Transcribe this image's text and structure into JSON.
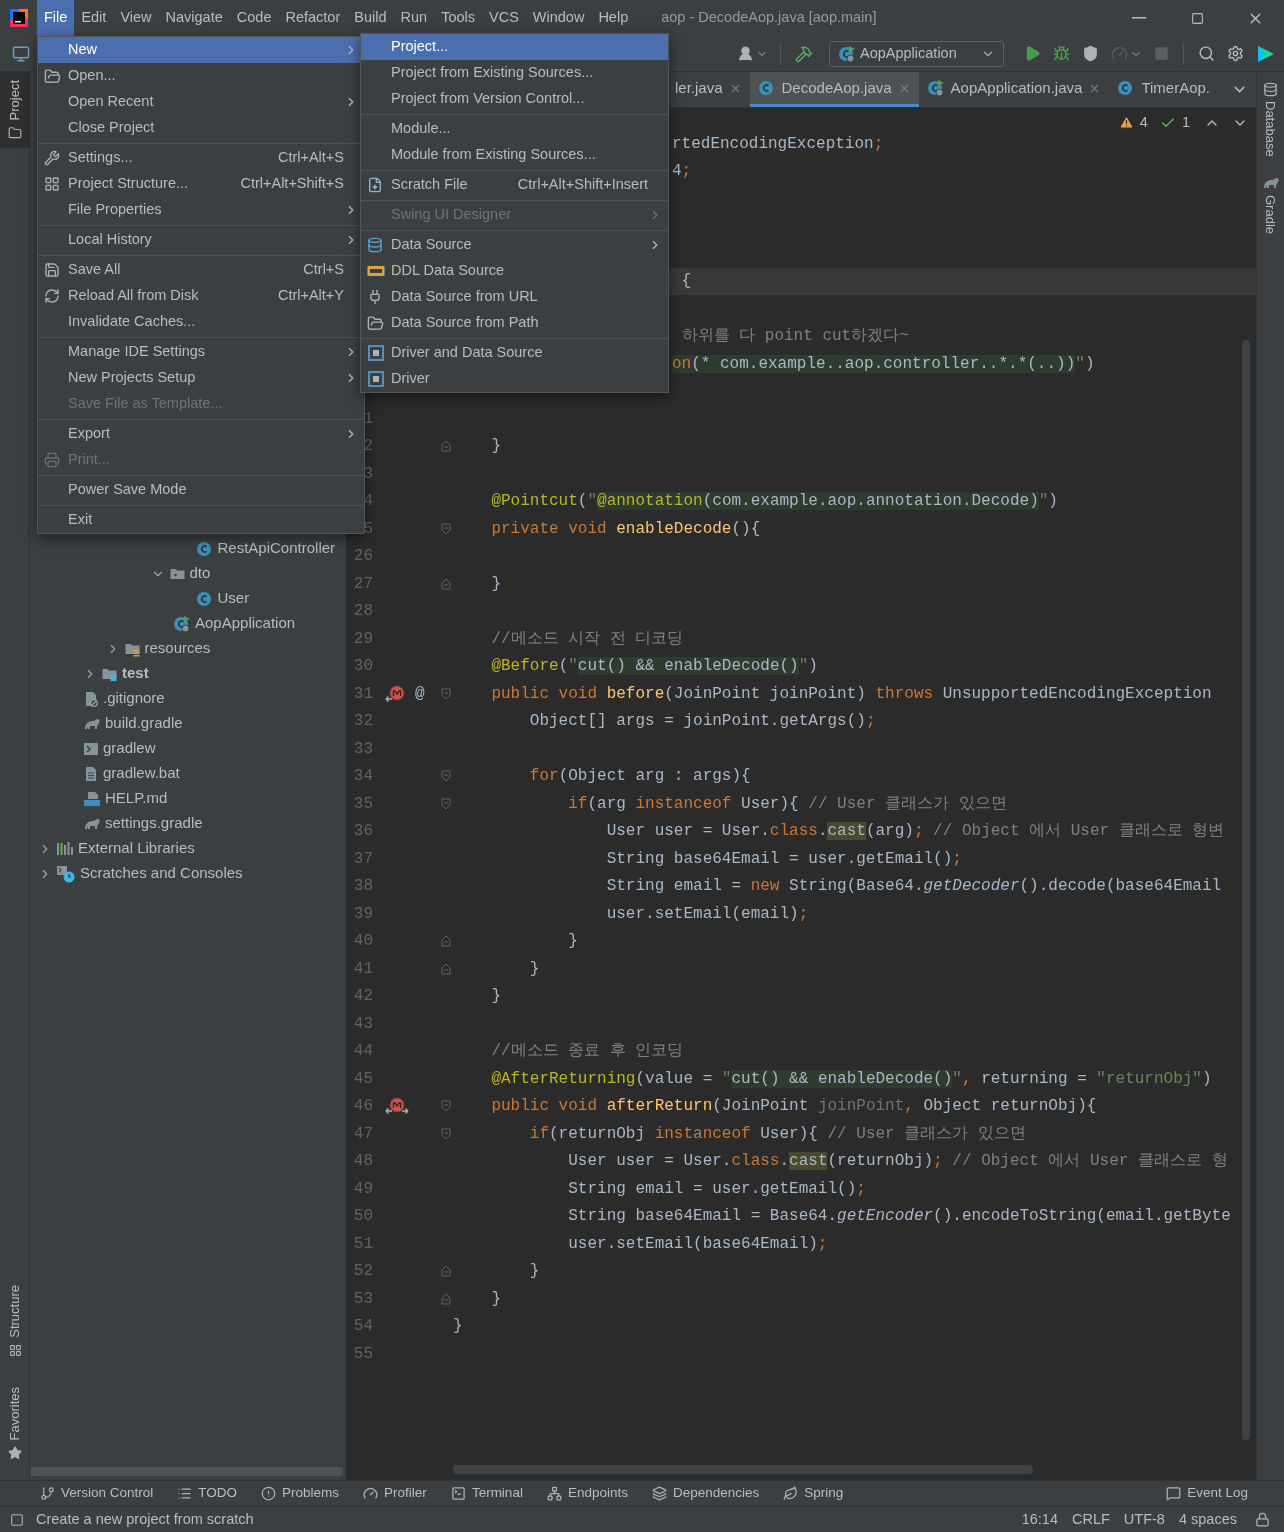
{
  "title_bar": {
    "menus": [
      {
        "label": "File",
        "selected": true
      },
      {
        "label": "Edit",
        "selected": false
      },
      {
        "label": "View",
        "selected": false
      },
      {
        "label": "Navigate",
        "selected": false
      },
      {
        "label": "Code",
        "selected": false
      },
      {
        "label": "Refactor",
        "selected": false
      },
      {
        "label": "Build",
        "selected": false
      },
      {
        "label": "Run",
        "selected": false
      },
      {
        "label": "Tools",
        "selected": false
      },
      {
        "label": "VCS",
        "selected": false
      },
      {
        "label": "Window",
        "selected": false
      },
      {
        "label": "Help",
        "selected": false
      }
    ],
    "title": "aop - DecodeAop.java [aop.main]"
  },
  "toolbar": {
    "run_configuration": "AopApplication"
  },
  "left_strip": {
    "top": [
      {
        "label": "Project",
        "selected": true,
        "kind": "folder"
      }
    ],
    "bottom": [
      {
        "label": "Structure",
        "selected": false,
        "kind": "structure"
      },
      {
        "label": "Favorites",
        "selected": false,
        "kind": "star"
      }
    ]
  },
  "right_strip": [
    {
      "label": "Database",
      "kind": "database"
    },
    {
      "label": "Gradle",
      "kind": "elephant"
    }
  ],
  "project_tree": [
    {
      "children": [
        {
          "children": [
            {
              "children": [
                {
                  "children": [
                    {
                      "children": [
                        {
                          "children": [
                            {
                              "label": "RestApiController",
                              "kind": "class"
                            }
                          ]
                        },
                        {
                          "label": "dto",
                          "kind": "package",
                          "expanded": true,
                          "children": [
                            {
                              "label": "User",
                              "kind": "class"
                            }
                          ]
                        },
                        {
                          "label": "AopApplication",
                          "kind": "app"
                        }
                      ]
                    }
                  ]
                },
                {
                  "label": "resources",
                  "kind": "resources",
                  "expanded": false
                }
              ]
            },
            {
              "label": "test",
              "kind": "test_root",
              "expanded": false
            }
          ]
        },
        {
          "label": ".gitignore",
          "kind": "ignore"
        },
        {
          "label": "build.gradle",
          "kind": "gradle"
        },
        {
          "label": "gradlew",
          "kind": "shell"
        },
        {
          "label": "gradlew.bat",
          "kind": "text"
        },
        {
          "label": "HELP.md",
          "kind": "markdown"
        },
        {
          "label": "settings.gradle",
          "kind": "gradle"
        }
      ]
    },
    {
      "label": "External Libraries",
      "kind": "libraries",
      "expanded": false
    },
    {
      "label": "Scratches and Consoles",
      "kind": "scratches",
      "expanded": false
    }
  ],
  "editor": {
    "tabs": [
      {
        "label": "ler.java",
        "selected": false,
        "closable": true
      },
      {
        "label": "DecodeAop.java",
        "kind": "class",
        "selected": true,
        "closable": true
      },
      {
        "label": "AopApplication.java",
        "kind": "app",
        "selected": false,
        "closable": true
      },
      {
        "label": "TimerAop.",
        "kind": "class",
        "selected": false,
        "closable": false
      }
    ],
    "inspections": {
      "warnings": "4",
      "weak_warnings": "1"
    },
    "lines": [
      {
        "kind": "clipped",
        "tokens": [
          {
            "text": "rtedEncodingException",
            "kind": "plain"
          },
          {
            "text": ";",
            "kind": "kw"
          }
        ]
      },
      {
        "kind": "clipped",
        "tokens": [
          {
            "text": "4",
            "kind": "plain"
          },
          {
            "text": ";",
            "kind": "kw"
          }
        ]
      },
      {
        "kind": "blank"
      },
      {
        "kind": "blank"
      },
      {
        "kind": "blank"
      },
      {
        "kind": "clipped",
        "current": true,
        "tokens": [
          {
            "text": " {",
            "kind": "plain"
          }
        ]
      },
      {
        "kind": "blank"
      },
      {
        "kind": "clipped",
        "tokens": [
          {
            "text": " 하위를 다 point cut하겠다~",
            "kind": "com"
          }
        ]
      },
      {
        "kind": "clipped",
        "tokens": [
          {
            "text": "on",
            "kind": "injkw"
          },
          {
            "text": "(* com.example..aop.controller..*.*(..))",
            "kind": "inj"
          },
          {
            "text": "\"",
            "kind": "str"
          },
          {
            "text": ")",
            "kind": "plain"
          }
        ]
      },
      {
        "kind": "blank"
      },
      {
        "kind": "blank",
        "n": "1"
      },
      {
        "kind": "code",
        "n": "2",
        "fold": {
          "kind": "end"
        },
        "tokens": [
          {
            "text": "    }",
            "kind": "plain"
          }
        ]
      },
      {
        "kind": "blank",
        "n": "3"
      },
      {
        "kind": "code",
        "n": "4",
        "tokens": [
          {
            "text": "    @Pointcut",
            "kind": "ann"
          },
          {
            "text": "(",
            "kind": "plain"
          },
          {
            "text": "\"",
            "kind": "str"
          },
          {
            "text": "@annotation",
            "kind": "injann"
          },
          {
            "text": "(com.example.aop.annotation.Decode)",
            "kind": "inj"
          },
          {
            "text": "\"",
            "kind": "str"
          },
          {
            "text": ")",
            "kind": "plain"
          }
        ]
      },
      {
        "kind": "code",
        "n": "5",
        "fold": {
          "kind": "start"
        },
        "tokens": [
          {
            "text": "    private void ",
            "kind": "kw"
          },
          {
            "text": "enableDecode",
            "kind": "method"
          },
          {
            "text": "(){",
            "kind": "plain"
          }
        ]
      },
      {
        "kind": "blank",
        "n": "26"
      },
      {
        "kind": "code",
        "n": "27",
        "fold": {
          "kind": "end"
        },
        "tokens": [
          {
            "text": "    }",
            "kind": "plain"
          }
        ]
      },
      {
        "kind": "blank",
        "n": "28"
      },
      {
        "kind": "code",
        "n": "29",
        "tokens": [
          {
            "text": "    //메소드 시작 전 디코딩",
            "kind": "com"
          }
        ]
      },
      {
        "kind": "code",
        "n": "30",
        "tokens": [
          {
            "text": "    @Before",
            "kind": "ann"
          },
          {
            "text": "(",
            "kind": "plain"
          },
          {
            "text": "\"",
            "kind": "str"
          },
          {
            "text": "cut() && enableDecode()",
            "kind": "inj"
          },
          {
            "text": "\"",
            "kind": "str"
          },
          {
            "text": ")",
            "kind": "plain"
          }
        ]
      },
      {
        "kind": "code",
        "n": "31",
        "fold": {
          "kind": "start"
        },
        "advice": {
          "kind": "method"
        },
        "mark": "@",
        "tokens": [
          {
            "text": "    public void ",
            "kind": "kw"
          },
          {
            "text": "before",
            "kind": "method"
          },
          {
            "text": "(JoinPoint joinPoint) ",
            "kind": "plain"
          },
          {
            "text": "throws ",
            "kind": "kw"
          },
          {
            "text": "UnsupportedEncodingException",
            "kind": "plain"
          }
        ]
      },
      {
        "kind": "code",
        "n": "32",
        "tokens": [
          {
            "text": "        Object[] args = joinPoint.getArgs()",
            "kind": "plain"
          },
          {
            "text": ";",
            "kind": "kw"
          }
        ]
      },
      {
        "kind": "blank",
        "n": "33"
      },
      {
        "kind": "code",
        "n": "34",
        "fold": {
          "kind": "start"
        },
        "tokens": [
          {
            "text": "        for",
            "kind": "kw"
          },
          {
            "text": "(Object arg : args){",
            "kind": "plain"
          }
        ]
      },
      {
        "kind": "code",
        "n": "35",
        "fold": {
          "kind": "start"
        },
        "tokens": [
          {
            "text": "            if",
            "kind": "kw"
          },
          {
            "text": "(arg ",
            "kind": "plain"
          },
          {
            "text": "instanceof ",
            "kind": "kw"
          },
          {
            "text": "User){ ",
            "kind": "plain"
          },
          {
            "text": "// User 클래스가 있으면",
            "kind": "com"
          }
        ]
      },
      {
        "kind": "code",
        "n": "36",
        "tokens": [
          {
            "text": "                User user = User.",
            "kind": "plain"
          },
          {
            "text": "class",
            "kind": "kw"
          },
          {
            "text": ".",
            "kind": "plain"
          },
          {
            "text": "cast",
            "kind": "usage"
          },
          {
            "text": "(arg)",
            "kind": "plain"
          },
          {
            "text": ";",
            "kind": "kw"
          },
          {
            "text": " // Object 에서 User 클래스로 형변",
            "kind": "com"
          }
        ]
      },
      {
        "kind": "code",
        "n": "37",
        "tokens": [
          {
            "text": "                String base64Email = user.getEmail()",
            "kind": "plain"
          },
          {
            "text": ";",
            "kind": "kw"
          }
        ]
      },
      {
        "kind": "code",
        "n": "38",
        "tokens": [
          {
            "text": "                String email = ",
            "kind": "plain"
          },
          {
            "text": "new ",
            "kind": "kw"
          },
          {
            "text": "String(Base64.",
            "kind": "plain"
          },
          {
            "text": "getDecoder",
            "kind": "static"
          },
          {
            "text": "().decode(base64Email",
            "kind": "plain"
          }
        ]
      },
      {
        "kind": "code",
        "n": "39",
        "tokens": [
          {
            "text": "                user.setEmail(email)",
            "kind": "plain"
          },
          {
            "text": ";",
            "kind": "kw"
          }
        ]
      },
      {
        "kind": "code",
        "n": "40",
        "fold": {
          "kind": "end"
        },
        "tokens": [
          {
            "text": "            }",
            "kind": "plain"
          }
        ]
      },
      {
        "kind": "code",
        "n": "41",
        "fold": {
          "kind": "end"
        },
        "tokens": [
          {
            "text": "        }",
            "kind": "plain"
          }
        ]
      },
      {
        "kind": "code",
        "n": "42",
        "tokens": [
          {
            "text": "    }",
            "kind": "plain"
          }
        ]
      },
      {
        "kind": "blank",
        "n": "43"
      },
      {
        "kind": "code",
        "n": "44",
        "tokens": [
          {
            "text": "    //메소드 종료 후 인코딩",
            "kind": "com"
          }
        ]
      },
      {
        "kind": "code",
        "n": "45",
        "tokens": [
          {
            "text": "    @AfterReturning",
            "kind": "ann"
          },
          {
            "text": "(value = ",
            "kind": "plain"
          },
          {
            "text": "\"",
            "kind": "str"
          },
          {
            "text": "cut() && enableDecode()",
            "kind": "inj"
          },
          {
            "text": "\"",
            "kind": "str"
          },
          {
            "text": ", ",
            "kind": "kw"
          },
          {
            "text": "returning = ",
            "kind": "plain"
          },
          {
            "text": "\"returnObj\"",
            "kind": "str"
          },
          {
            "text": ")",
            "kind": "plain"
          }
        ]
      },
      {
        "kind": "code",
        "n": "46",
        "fold": {
          "kind": "start"
        },
        "advice": {
          "kind": "return"
        },
        "tokens": [
          {
            "text": "    public void ",
            "kind": "kw"
          },
          {
            "text": "afterReturn",
            "kind": "method"
          },
          {
            "text": "(JoinPoint ",
            "kind": "plain"
          },
          {
            "text": "joinPoint",
            "kind": "unused"
          },
          {
            "text": ", ",
            "kind": "kw"
          },
          {
            "text": "Object returnObj){",
            "kind": "plain"
          }
        ]
      },
      {
        "kind": "code",
        "n": "47",
        "fold": {
          "kind": "start"
        },
        "tokens": [
          {
            "text": "        if",
            "kind": "kw"
          },
          {
            "text": "(returnObj ",
            "kind": "plain"
          },
          {
            "text": "instanceof ",
            "kind": "kw"
          },
          {
            "text": "User){ ",
            "kind": "plain"
          },
          {
            "text": "// User 클래스가 있으면",
            "kind": "com"
          }
        ]
      },
      {
        "kind": "code",
        "n": "48",
        "tokens": [
          {
            "text": "            User user = User.",
            "kind": "plain"
          },
          {
            "text": "class",
            "kind": "kw"
          },
          {
            "text": ".",
            "kind": "plain"
          },
          {
            "text": "cast",
            "kind": "usage"
          },
          {
            "text": "(returnObj)",
            "kind": "plain"
          },
          {
            "text": ";",
            "kind": "kw"
          },
          {
            "text": " // Object 에서 User 클래스로 형",
            "kind": "com"
          }
        ]
      },
      {
        "kind": "code",
        "n": "49",
        "tokens": [
          {
            "text": "            String email = user.getEmail()",
            "kind": "plain"
          },
          {
            "text": ";",
            "kind": "kw"
          }
        ]
      },
      {
        "kind": "code",
        "n": "50",
        "tokens": [
          {
            "text": "            String base64Email = Base64.",
            "kind": "plain"
          },
          {
            "text": "getEncoder",
            "kind": "static"
          },
          {
            "text": "().encodeToString(email.getByte",
            "kind": "plain"
          }
        ]
      },
      {
        "kind": "code",
        "n": "51",
        "tokens": [
          {
            "text": "            user.setEmail(base64Email)",
            "kind": "plain"
          },
          {
            "text": ";",
            "kind": "kw"
          }
        ]
      },
      {
        "kind": "code",
        "n": "52",
        "fold": {
          "kind": "end"
        },
        "tokens": [
          {
            "text": "        }",
            "kind": "plain"
          }
        ]
      },
      {
        "kind": "code",
        "n": "53",
        "fold": {
          "kind": "end"
        },
        "tokens": [
          {
            "text": "    }",
            "kind": "plain"
          }
        ]
      },
      {
        "kind": "code",
        "n": "54",
        "tokens": [
          {
            "text": "}",
            "kind": "plain"
          }
        ]
      },
      {
        "kind": "blank",
        "n": "55"
      }
    ]
  },
  "bottom_tools": [
    {
      "label": "Version Control",
      "kind": "branch"
    },
    {
      "label": "TODO",
      "kind": "list"
    },
    {
      "label": "Problems",
      "kind": "problems"
    },
    {
      "label": "Profiler",
      "kind": "profiler"
    },
    {
      "label": "Terminal",
      "kind": "terminal"
    },
    {
      "label": "Endpoints",
      "kind": "endpoints"
    },
    {
      "label": "Dependencies",
      "kind": "layers"
    },
    {
      "label": "Spring",
      "kind": "leaf"
    }
  ],
  "event_log": "Event Log",
  "status_bar": {
    "message": "Create a new project from scratch",
    "items": [
      "16:14",
      "CRLF",
      "UTF-8",
      "4 spaces"
    ]
  },
  "file_menu": [
    {
      "kind": "text",
      "label": "New",
      "selected": true,
      "disabled": false,
      "submenu": true
    },
    {
      "kind": "folder",
      "label": "Open...",
      "selected": false,
      "disabled": false,
      "submenu": false
    },
    {
      "kind": "text",
      "label": "Open Recent",
      "selected": false,
      "disabled": false,
      "submenu": true
    },
    {
      "kind": "text",
      "label": "Close Project",
      "selected": false,
      "disabled": false,
      "submenu": false
    },
    {
      "kind": "separator"
    },
    {
      "kind": "wrench",
      "label": "Settings...",
      "selected": false,
      "disabled": false,
      "submenu": false,
      "shortcut": "Ctrl+Alt+S"
    },
    {
      "kind": "structure",
      "label": "Project Structure...",
      "selected": false,
      "disabled": false,
      "submenu": false,
      "shortcut": "Ctrl+Alt+Shift+S"
    },
    {
      "kind": "text",
      "label": "File Properties",
      "selected": false,
      "disabled": false,
      "submenu": true
    },
    {
      "kind": "separator"
    },
    {
      "kind": "text",
      "label": "Local History",
      "selected": false,
      "disabled": false,
      "submenu": true
    },
    {
      "kind": "separator"
    },
    {
      "kind": "save",
      "label": "Save All",
      "selected": false,
      "disabled": false,
      "submenu": false,
      "shortcut": "Ctrl+S"
    },
    {
      "kind": "reload",
      "label": "Reload All from Disk",
      "selected": false,
      "disabled": false,
      "submenu": false,
      "shortcut": "Ctrl+Alt+Y"
    },
    {
      "kind": "text",
      "label": "Invalidate Caches...",
      "selected": false,
      "disabled": false,
      "submenu": false
    },
    {
      "kind": "separator"
    },
    {
      "kind": "text",
      "label": "Manage IDE Settings",
      "selected": false,
      "disabled": false,
      "submenu": true
    },
    {
      "kind": "text",
      "label": "New Projects Setup",
      "selected": false,
      "disabled": false,
      "submenu": true
    },
    {
      "kind": "text",
      "label": "Save File as Template...",
      "selected": false,
      "disabled": true,
      "submenu": false
    },
    {
      "kind": "separator"
    },
    {
      "kind": "text",
      "label": "Export",
      "selected": false,
      "disabled": false,
      "submenu": true
    },
    {
      "kind": "printer",
      "label": "Print...",
      "selected": false,
      "disabled": true,
      "submenu": false
    },
    {
      "kind": "separator"
    },
    {
      "kind": "text",
      "label": "Power Save Mode",
      "selected": false,
      "disabled": false,
      "submenu": false
    },
    {
      "kind": "separator"
    },
    {
      "kind": "text",
      "label": "Exit",
      "selected": false,
      "disabled": false,
      "submenu": false
    }
  ],
  "new_submenu": [
    {
      "kind": "text",
      "label": "Project...",
      "selected": true,
      "disabled": false,
      "submenu": false
    },
    {
      "kind": "text",
      "label": "Project from Existing Sources...",
      "selected": false,
      "disabled": false,
      "submenu": false
    },
    {
      "kind": "text",
      "label": "Project from Version Control...",
      "selected": false,
      "disabled": false,
      "submenu": false
    },
    {
      "kind": "separator"
    },
    {
      "kind": "text",
      "label": "Module...",
      "selected": false,
      "disabled": false,
      "submenu": false
    },
    {
      "kind": "text",
      "label": "Module from Existing Sources...",
      "selected": false,
      "disabled": false,
      "submenu": false
    },
    {
      "kind": "separator"
    },
    {
      "kind": "scratch",
      "label": "Scratch File",
      "selected": false,
      "disabled": false,
      "submenu": false,
      "shortcut": "Ctrl+Alt+Shift+Insert"
    },
    {
      "kind": "separator"
    },
    {
      "kind": "text",
      "label": "Swing UI Designer",
      "selected": false,
      "disabled": true,
      "submenu": true
    },
    {
      "kind": "separator"
    },
    {
      "kind": "database",
      "label": "Data Source",
      "selected": false,
      "disabled": false,
      "submenu": true
    },
    {
      "kind": "ddl",
      "label": "DDL Data Source",
      "selected": false,
      "disabled": false,
      "submenu": false
    },
    {
      "kind": "plug",
      "label": "Data Source from URL",
      "selected": false,
      "disabled": false,
      "submenu": false
    },
    {
      "kind": "folder",
      "label": "Data Source from Path",
      "selected": false,
      "disabled": false,
      "submenu": false
    },
    {
      "kind": "separator"
    },
    {
      "kind": "driver",
      "label": "Driver and Data Source",
      "selected": false,
      "disabled": false,
      "submenu": false
    },
    {
      "kind": "driver",
      "label": "Driver",
      "selected": false,
      "disabled": false,
      "submenu": false
    }
  ]
}
